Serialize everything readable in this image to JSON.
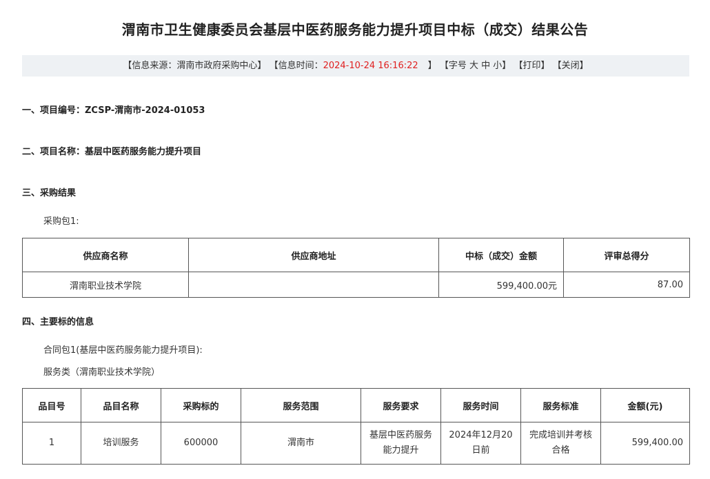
{
  "title": "渭南市卫生健康委员会基层中医药服务能力提升项目中标（成交）结果公告",
  "info_bar": {
    "source_label": "【信息来源：",
    "source_value": "渭南市政府采购中心】",
    "time_label": "【信息时间：",
    "time_value": "2024-10-24 16:16:22",
    "time_close": "】",
    "font_label": "【字号",
    "font_large": "大",
    "font_medium": "中",
    "font_small": "小】",
    "print": "【打印】",
    "close": "【关闭】"
  },
  "sections": {
    "project_no": "一、项目编号：ZCSP-渭南市-2024-01053",
    "project_name": "二、项目名称：基层中医药服务能力提升项目",
    "result": "三、采购结果",
    "package": "采购包1:",
    "main_info": "四、主要标的信息",
    "contract_package": "合同包1(基层中医药服务能力提升项目):",
    "service_type": "服务类（渭南职业技术学院）"
  },
  "result_table": {
    "headers": [
      "供应商名称",
      "供应商地址",
      "中标（成交）金额",
      "评审总得分"
    ],
    "rows": [
      [
        "渭南职业技术学院",
        "",
        "599,400.00元",
        "87.00"
      ]
    ]
  },
  "service_table": {
    "headers": [
      "品目号",
      "品目名称",
      "采购标的",
      "服务范围",
      "服务要求",
      "服务时间",
      "服务标准",
      "金额(元)"
    ],
    "rows": [
      [
        "1",
        "培训服务",
        "600000",
        "渭南市",
        "基层中医药服务能力提升",
        "2024年12月20日前",
        "完成培训并考核合格",
        "599,400.00"
      ]
    ]
  }
}
